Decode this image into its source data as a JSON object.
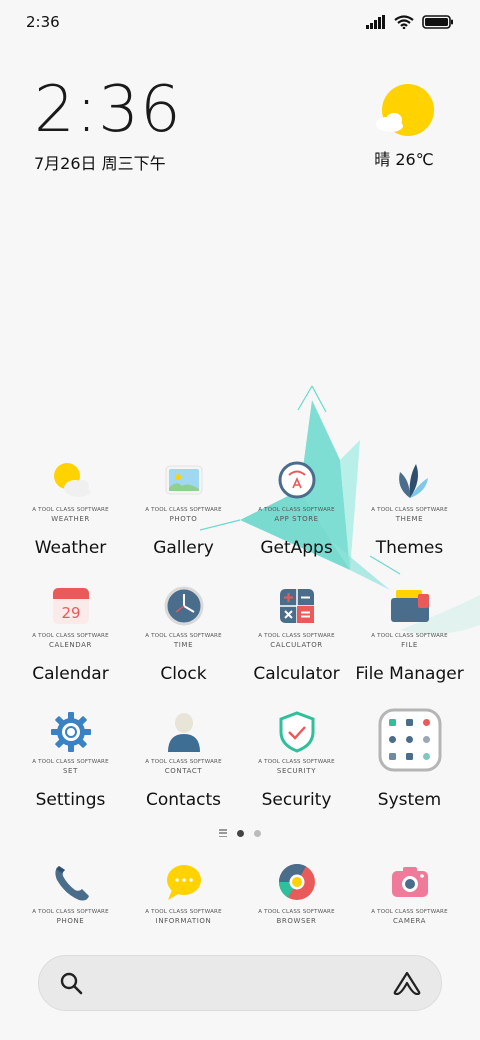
{
  "status_bar": {
    "time": "2:36",
    "icons": [
      "signal-icon",
      "wifi-icon",
      "battery-icon"
    ]
  },
  "clock_widget": {
    "time": "2:36",
    "date": "7月26日 周三下午"
  },
  "weather_widget": {
    "text": "晴 26℃",
    "icon": "sun-cloud-icon"
  },
  "apps": [
    {
      "label": "Weather",
      "caption": "A TOOL CLASS SOFTWARE",
      "tag": "WEATHER",
      "icon": "weather-icon"
    },
    {
      "label": "Gallery",
      "caption": "A TOOL CLASS SOFTWARE",
      "tag": "PHOTO",
      "icon": "gallery-icon"
    },
    {
      "label": "GetApps",
      "caption": "A TOOL CLASS SOFTWARE",
      "tag": "APP STORE",
      "icon": "getapps-icon"
    },
    {
      "label": "Themes",
      "caption": "A TOOL CLASS SOFTWARE",
      "tag": "THEME",
      "icon": "themes-icon"
    },
    {
      "label": "Calendar",
      "caption": "A TOOL CLASS SOFTWARE",
      "tag": "CALENDAR",
      "icon": "calendar-icon",
      "day": "29"
    },
    {
      "label": "Clock",
      "caption": "A TOOL CLASS SOFTWARE",
      "tag": "TIME",
      "icon": "clock-icon"
    },
    {
      "label": "Calculator",
      "caption": "A TOOL CLASS SOFTWARE",
      "tag": "CALCULATOR",
      "icon": "calculator-icon"
    },
    {
      "label": "File Manager",
      "caption": "A TOOL CLASS SOFTWARE",
      "tag": "FILE",
      "icon": "folder-icon"
    },
    {
      "label": "Settings",
      "caption": "A TOOL CLASS SOFTWARE",
      "tag": "SET",
      "icon": "gear-icon"
    },
    {
      "label": "Contacts",
      "caption": "A TOOL CLASS SOFTWARE",
      "tag": "CONTACT",
      "icon": "person-icon"
    },
    {
      "label": "Security",
      "caption": "A TOOL CLASS SOFTWARE",
      "tag": "SECURITY",
      "icon": "shield-icon"
    },
    {
      "label": "System",
      "caption": "",
      "tag": "",
      "icon": "system-folder-icon"
    }
  ],
  "page_indicator": {
    "pages": 2,
    "active": 0
  },
  "dock": [
    {
      "caption": "A TOOL CLASS SOFTWARE",
      "tag": "PHONE",
      "icon": "phone-icon"
    },
    {
      "caption": "A TOOL CLASS SOFTWARE",
      "tag": "INFORMATION",
      "icon": "message-icon"
    },
    {
      "caption": "A TOOL CLASS SOFTWARE",
      "tag": "BROWSER",
      "icon": "browser-icon"
    },
    {
      "caption": "A TOOL CLASS SOFTWARE",
      "tag": "CAMERA",
      "icon": "camera-icon"
    }
  ],
  "search_bar": {
    "placeholder": "",
    "left_icon": "search-icon",
    "right_icon": "assistant-icon"
  },
  "colors": {
    "sun": "#FFD200",
    "teal": "#4fd6c8",
    "blue_gray": "#4a6d8c",
    "red": "#e95a5a"
  }
}
